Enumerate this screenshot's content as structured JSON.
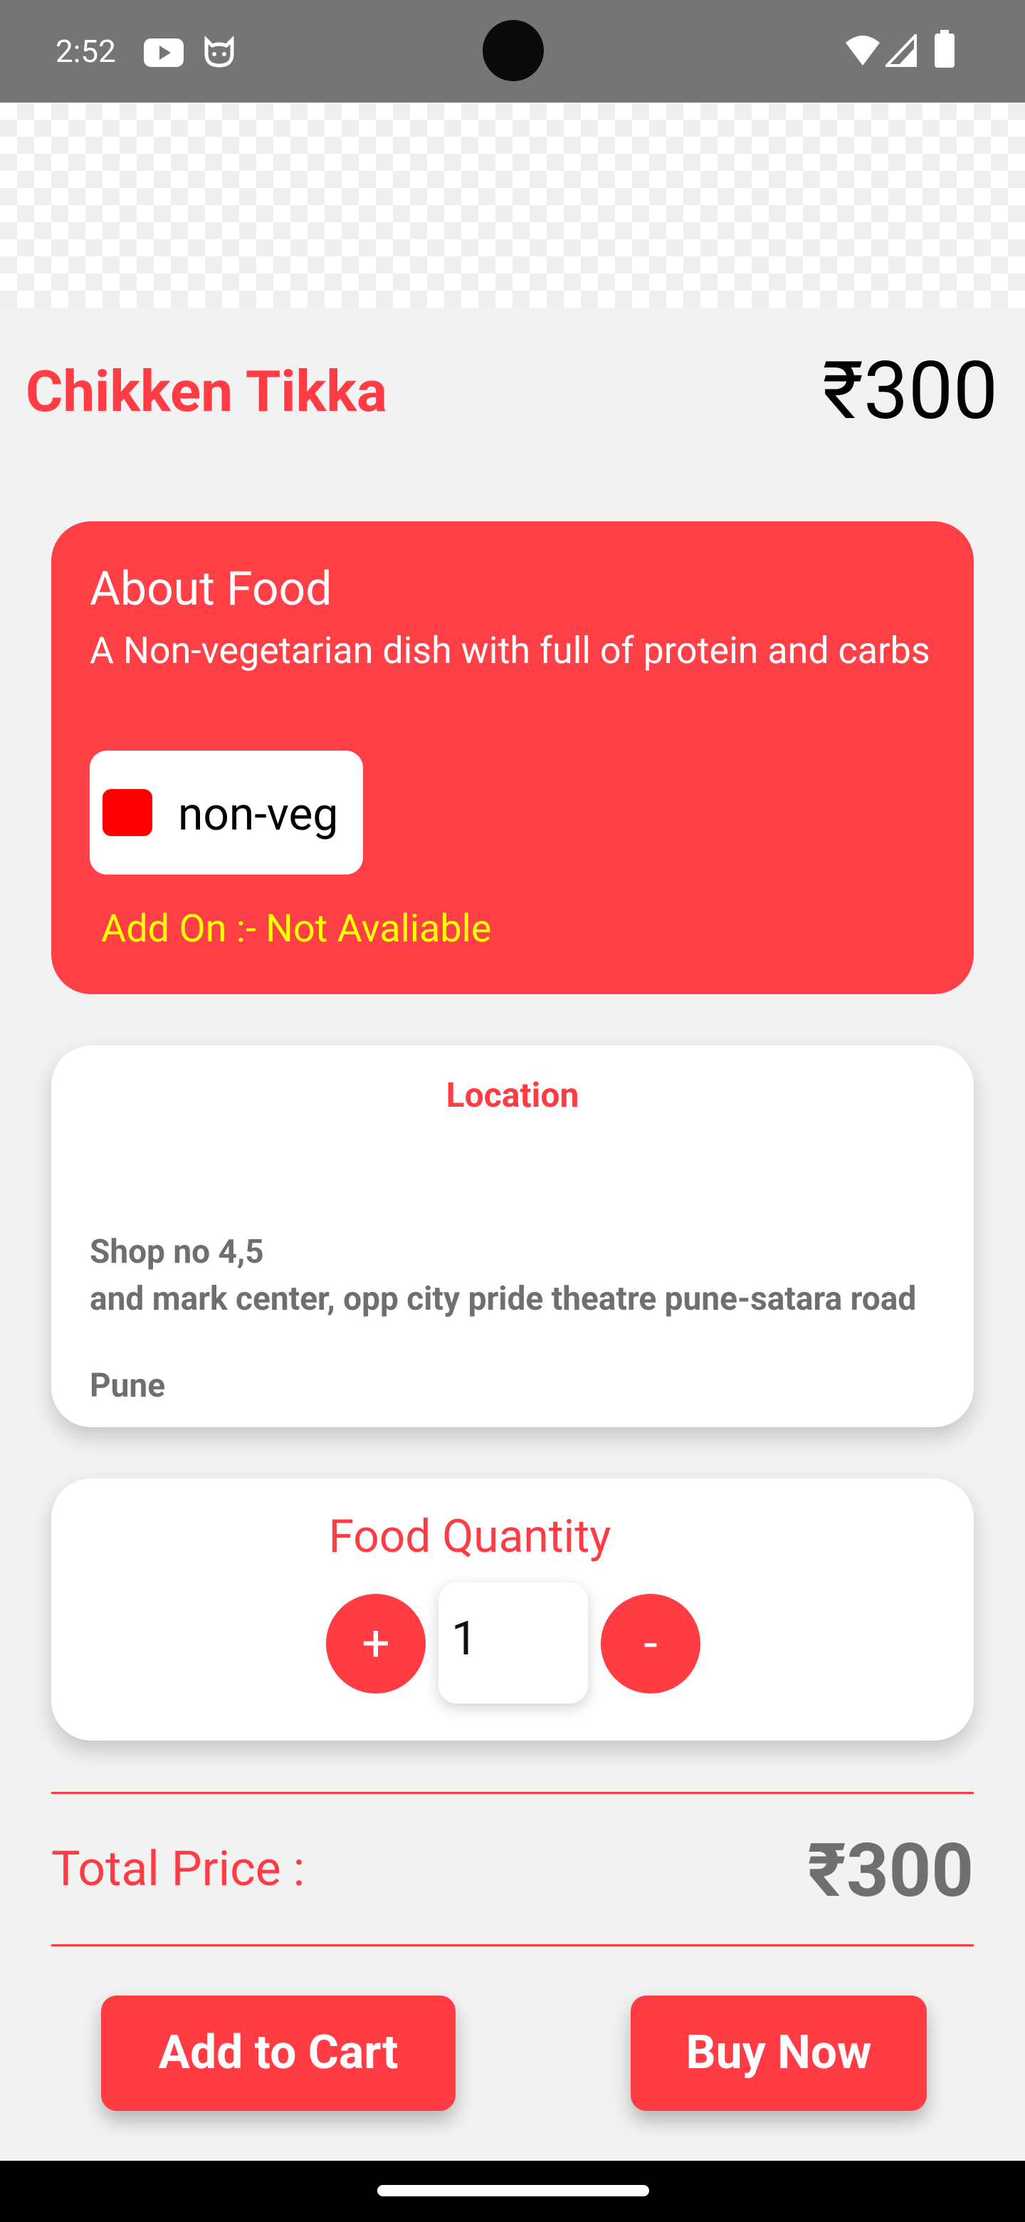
{
  "status_bar": {
    "time": "2:52",
    "left_icons": [
      "youtube-icon",
      "cat-face-icon"
    ],
    "right_icons": [
      "wifi-icon",
      "cell-signal-icon",
      "battery-icon"
    ]
  },
  "food": {
    "name": "Chikken Tikka",
    "price": "₹300"
  },
  "about": {
    "title": "About Food",
    "description": "A Non-vegetarian dish with full of protein and carbs",
    "type_label": "non-veg",
    "type_color": "#ff0000",
    "addon": "Add On :- Not Avaliable"
  },
  "location": {
    "title": "Location",
    "line1": "Shop no 4,5",
    "line2": "and mark center, opp city pride theatre pune-satara road",
    "line3": "Pune"
  },
  "quantity": {
    "title": "Food Quantity",
    "plus_label": "+",
    "minus_label": "-",
    "value": "1"
  },
  "total": {
    "label": "Total Price :",
    "value": "₹300"
  },
  "actions": {
    "add_to_cart": "Add to Cart",
    "buy_now": "Buy Now"
  },
  "colors": {
    "accent": "#ff3b44",
    "card_red": "#ff4047",
    "addon_text": "#ffff00"
  }
}
